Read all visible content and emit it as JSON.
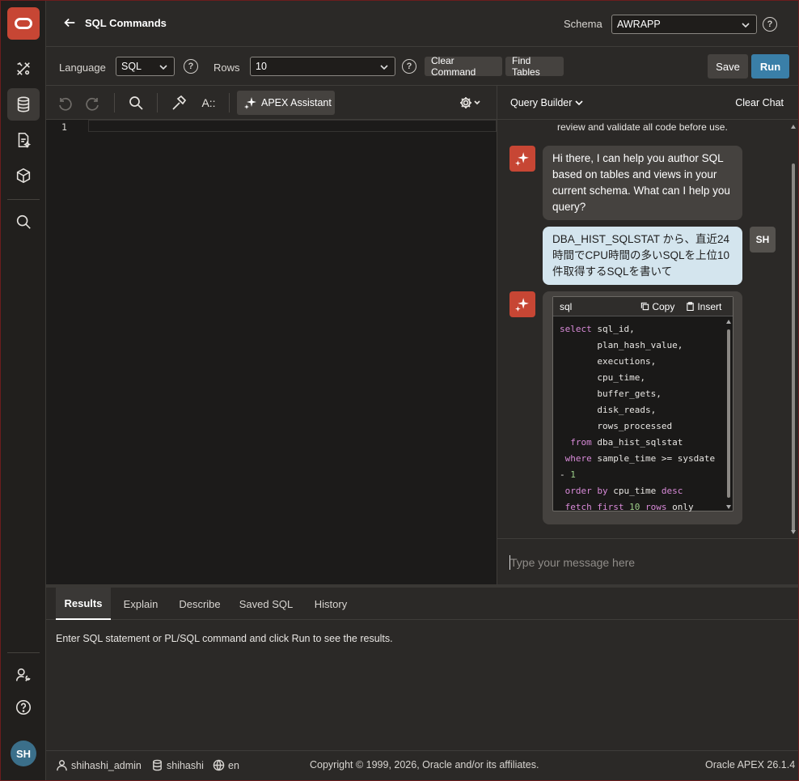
{
  "header": {
    "title": "SQL Commands",
    "schema_label": "Schema",
    "schema_value": "AWRAPP"
  },
  "options": {
    "language_label": "Language",
    "language_value": "SQL",
    "rows_label": "Rows",
    "rows_value": "10",
    "clear_command": "Clear Command",
    "find_tables": "Find Tables",
    "save": "Save",
    "run": "Run"
  },
  "editor_toolbar": {
    "assistant_label": "APEX Assistant",
    "font_icon_text": "A::"
  },
  "editor": {
    "line_numbers": [
      "1"
    ]
  },
  "chat_toolbar": {
    "query_builder": "Query Builder",
    "clear_chat": "Clear Chat"
  },
  "chat": {
    "notice": "review and validate all code before use.",
    "ai_greeting": "Hi there, I can help you author SQL based on tables and views in your current schema. What can I help you query?",
    "user_message": "DBA_HIST_SQLSTAT から、直近24時間でCPU時間の多いSQLを上位10件取得するSQLを書いて",
    "user_initials": "SH",
    "code_lang": "sql",
    "copy_label": "Copy",
    "insert_label": "Insert",
    "input_placeholder": "Type your message here"
  },
  "results": {
    "tabs": [
      "Results",
      "Explain",
      "Describe",
      "Saved SQL",
      "History"
    ],
    "message": "Enter SQL statement or PL/SQL command and click Run to see the results."
  },
  "footer": {
    "user": "shihashi_admin",
    "workspace": "shihashi",
    "language": "en",
    "copyright": "Copyright © 1999, 2026, Oracle and/or its affiliates.",
    "version": "Oracle APEX 26.1.4"
  },
  "nav": {
    "avatar_initials": "SH"
  },
  "colors": {
    "accent": "#c74634",
    "primary_button": "#3a7fa8",
    "user_bubble": "#d4e5ee"
  }
}
